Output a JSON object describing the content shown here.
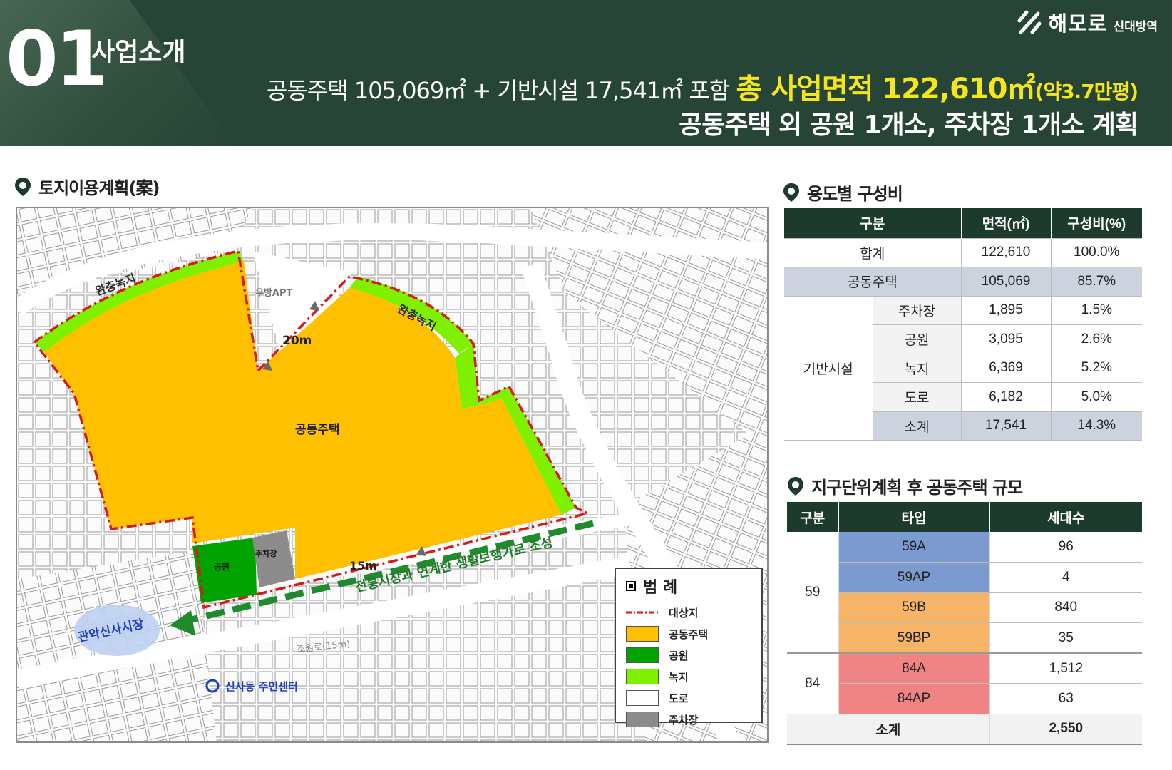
{
  "header": {
    "section_number": "01",
    "section_title": "사업소개",
    "brand_name": "해모로",
    "brand_sub": "신대방역",
    "headline_line1_prefix": "공동주택 105,069㎡ + 기반시설 17,541㎡ 포함",
    "headline_line1_highlight": "총 사업면적 122,610㎡",
    "headline_line1_highlight_small": "(약3.7만평)",
    "headline_line2": "공동주택 외 공원 1개소, 주차장 1개소 계획",
    "colors": {
      "band": "#264536",
      "highlight": "#f4e61a"
    }
  },
  "map_section": {
    "title": "토지이용계획(案)",
    "labels": {
      "green_buffer_left": "완충녹지",
      "green_buffer_right": "완충녹지",
      "apt": "우방APT",
      "road_20m": "20m",
      "housing": "공동주택",
      "park": "공원",
      "parking": "주차장",
      "road_15m": "15m",
      "walkway": "전통시장과 연계한 생활보행가로 조성",
      "market": "관악신사시장",
      "street": "조원로(15m)",
      "center": "신사동 주민센터"
    },
    "legend": {
      "title": "범 례",
      "items": [
        {
          "label": "대상지",
          "color": "#ffffff"
        },
        {
          "label": "공동주택",
          "color": "#ffc000"
        },
        {
          "label": "공원",
          "color": "#00a300"
        },
        {
          "label": "녹지",
          "color": "#7ef000"
        },
        {
          "label": "도로",
          "color": "#ffffff"
        },
        {
          "label": "주차장",
          "color": "#8c8c8c"
        }
      ]
    }
  },
  "usage_section": {
    "title": "용도별 구성비",
    "headers": [
      "구분",
      "면적(㎡)",
      "구성비(%)"
    ],
    "total": {
      "label": "합계",
      "area": "122,610",
      "ratio": "100.0%"
    },
    "housing": {
      "label": "공동주택",
      "area": "105,069",
      "ratio": "85.7%"
    },
    "group_label": "기반시설",
    "rows": [
      {
        "label": "주차장",
        "area": "1,895",
        "ratio": "1.5%"
      },
      {
        "label": "공원",
        "area": "3,095",
        "ratio": "2.6%"
      },
      {
        "label": "녹지",
        "area": "6,369",
        "ratio": "5.2%"
      },
      {
        "label": "도로",
        "area": "6,182",
        "ratio": "5.0%"
      },
      {
        "label": "소계",
        "area": "17,541",
        "ratio": "14.3%"
      }
    ]
  },
  "scale_section": {
    "title": "지구단위계획 후 공동주택 규모",
    "headers": [
      "구분",
      "타입",
      "세대수"
    ],
    "groups": [
      {
        "label": "59",
        "rows": [
          {
            "type": "59A",
            "units": "96"
          },
          {
            "type": "59AP",
            "units": "4"
          },
          {
            "type": "59B",
            "units": "840"
          },
          {
            "type": "59BP",
            "units": "35"
          }
        ]
      },
      {
        "label": "84",
        "rows": [
          {
            "type": "84A",
            "units": "1,512"
          },
          {
            "type": "84AP",
            "units": "63"
          }
        ]
      }
    ],
    "total": {
      "label": "소계",
      "units": "2,550"
    }
  }
}
